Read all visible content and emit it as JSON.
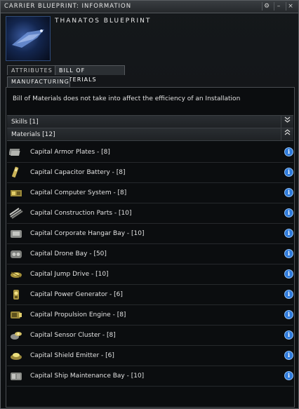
{
  "window": {
    "title": "CARRIER BLUEPRINT: INFORMATION",
    "buttons": {
      "pin": "⚙",
      "minimize": "–",
      "close": "×"
    }
  },
  "blueprint": {
    "name": "THANATOS BLUEPRINT"
  },
  "tabs": [
    {
      "label": "ATTRIBUTES",
      "active": false
    },
    {
      "label": "BILL OF MATERIALS",
      "active": true
    }
  ],
  "subtabs": [
    {
      "label": "MANUFACTURING"
    }
  ],
  "note": "Bill of Materials does not take into affect the efficiency of an Installation",
  "groups": {
    "skills": {
      "label": "Skills [1]",
      "toggle": "collapsed"
    },
    "materials": {
      "label": "Materials [12]",
      "toggle": "expanded"
    }
  },
  "materials": [
    {
      "label": "Capital Armor Plates - [8]",
      "icon": "armor-plates-icon"
    },
    {
      "label": "Capital Capacitor Battery - [8]",
      "icon": "capacitor-battery-icon"
    },
    {
      "label": "Capital Computer System - [8]",
      "icon": "computer-system-icon"
    },
    {
      "label": "Capital Construction Parts - [10]",
      "icon": "construction-parts-icon"
    },
    {
      "label": "Capital Corporate Hangar Bay - [10]",
      "icon": "hangar-bay-icon"
    },
    {
      "label": "Capital Drone Bay - [50]",
      "icon": "drone-bay-icon"
    },
    {
      "label": "Capital Jump Drive - [10]",
      "icon": "jump-drive-icon"
    },
    {
      "label": "Capital Power Generator - [6]",
      "icon": "power-generator-icon"
    },
    {
      "label": "Capital Propulsion Engine - [8]",
      "icon": "propulsion-engine-icon"
    },
    {
      "label": "Capital Sensor Cluster - [8]",
      "icon": "sensor-cluster-icon"
    },
    {
      "label": "Capital Shield Emitter - [6]",
      "icon": "shield-emitter-icon"
    },
    {
      "label": "Capital Ship Maintenance Bay - [10]",
      "icon": "maintenance-bay-icon"
    }
  ],
  "colors": {
    "accent_info": "#2f7bdc",
    "panel_border": "#55595d"
  }
}
